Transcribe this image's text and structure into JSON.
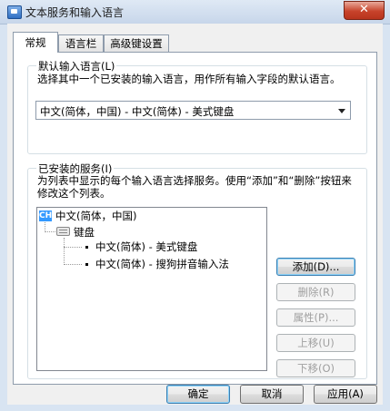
{
  "window": {
    "title": "文本服务和输入语言",
    "close_label": "✕"
  },
  "tabs": [
    {
      "label": "常规",
      "active": true
    },
    {
      "label": "语言栏",
      "active": false
    },
    {
      "label": "高级键设置",
      "active": false
    }
  ],
  "default_lang": {
    "legend": "默认输入语言(L)",
    "description": "选择其中一个已安装的输入语言，用作所有输入字段的默认语言。",
    "selected": "中文(简体，中国) - 中文(简体) - 美式键盘"
  },
  "installed": {
    "legend": "已安装的服务(I)",
    "description": "为列表中显示的每个输入语言选择服务。使用“添加”和“删除”按钮来修改这个列表。",
    "tree": {
      "lang_icon": "CH",
      "language": "中文(简体，中国)",
      "category": "键盘",
      "services": [
        "中文(简体) - 美式键盘",
        "中文(简体) - 搜狗拼音输入法"
      ]
    },
    "buttons": {
      "add": "添加(D)...",
      "remove": "删除(R)",
      "properties": "属性(P)...",
      "move_up": "上移(U)",
      "move_down": "下移(O)"
    }
  },
  "footer": {
    "ok": "确定",
    "cancel": "取消",
    "apply": "应用(A)"
  },
  "colors": {
    "selection": "#3399ff",
    "close_button": "#c7432b"
  }
}
